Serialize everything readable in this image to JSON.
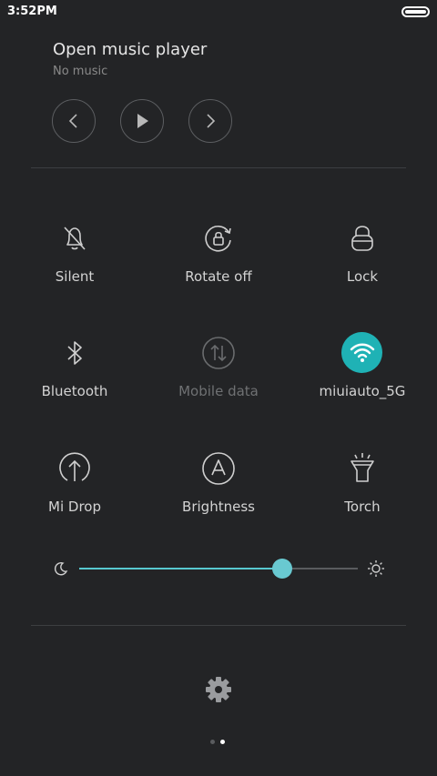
{
  "status": {
    "time": "3:52PM",
    "battery_icon": "battery-full-icon"
  },
  "music": {
    "title": "Open music player",
    "subtitle": "No music",
    "controls": [
      "previous-icon",
      "play-icon",
      "next-icon"
    ]
  },
  "tiles": [
    {
      "label": "Silent",
      "icon": "bell-off-icon",
      "active": false,
      "enabled": true
    },
    {
      "label": "Rotate off",
      "icon": "rotate-lock-icon",
      "active": false,
      "enabled": true
    },
    {
      "label": "Lock",
      "icon": "lock-icon",
      "active": false,
      "enabled": true
    },
    {
      "label": "Bluetooth",
      "icon": "bluetooth-icon",
      "active": false,
      "enabled": true
    },
    {
      "label": "Mobile data",
      "icon": "mobile-data-icon",
      "active": false,
      "enabled": false
    },
    {
      "label": "miuiauto_5G",
      "icon": "wifi-icon",
      "active": true,
      "enabled": true
    },
    {
      "label": "Mi Drop",
      "icon": "mi-drop-icon",
      "active": false,
      "enabled": true
    },
    {
      "label": "Brightness",
      "icon": "auto-brightness-icon",
      "active": false,
      "enabled": true
    },
    {
      "label": "Torch",
      "icon": "torch-icon",
      "active": false,
      "enabled": true
    }
  ],
  "brightness": {
    "level_percent": 73,
    "min_icon": "moon-icon",
    "max_icon": "sun-icon"
  },
  "footer": {
    "settings_icon": "gear-icon",
    "page_count": 2,
    "current_page": 2
  },
  "colors": {
    "background": "#232426",
    "accent": "#1fb2b5",
    "slider_fill": "#57c9cf",
    "text": "#d3d3d3",
    "text_dim": "#6f7173"
  }
}
